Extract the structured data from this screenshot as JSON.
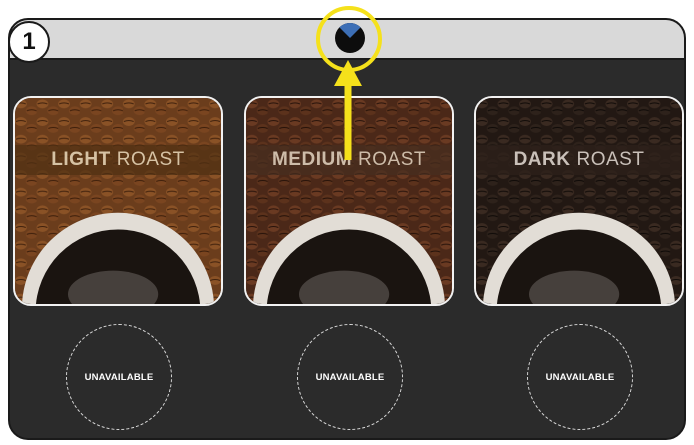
{
  "step": "1",
  "colors": {
    "screen_bg": "#2b2b2b",
    "top_bar": "#d9d9d9",
    "highlight": "#f5e11b",
    "status_accent": "#3d6fb6"
  },
  "status_icon": "timer-icon",
  "roasts": [
    {
      "strong": "LIGHT",
      "weak": "ROAST",
      "availability": "UNAVAILABLE"
    },
    {
      "strong": "MEDIUM",
      "weak": "ROAST",
      "availability": "UNAVAILABLE"
    },
    {
      "strong": "DARK",
      "weak": "ROAST",
      "availability": "UNAVAILABLE"
    }
  ]
}
